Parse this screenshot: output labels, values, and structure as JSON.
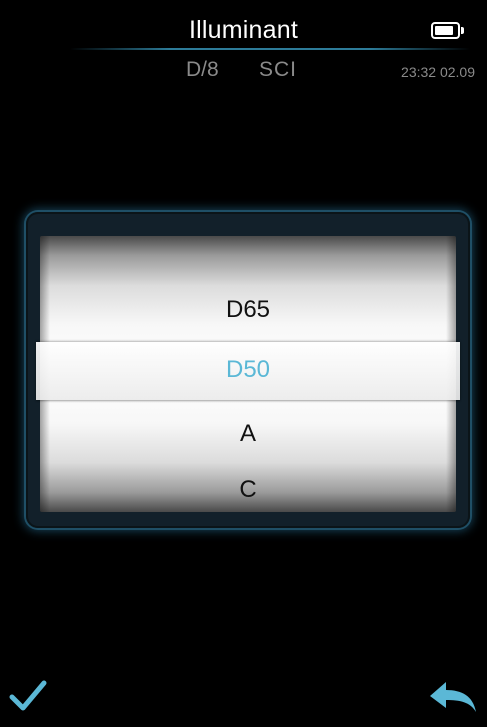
{
  "header": {
    "title": "Illuminant",
    "geometry": "D/8",
    "component": "SCI",
    "clock": "23:32 02.09"
  },
  "battery": {
    "icon": "battery-icon",
    "level": 0.85
  },
  "picker": {
    "options": [
      "D65",
      "D50",
      "A",
      "C"
    ],
    "selected": "D50"
  },
  "footer": {
    "confirm_icon": "checkmark-icon",
    "back_icon": "back-arrow-icon"
  },
  "colors": {
    "accent": "#5bb8d6",
    "frame_glow": "#2d7c99",
    "background": "#000000",
    "muted_text": "#8a8a8a"
  }
}
